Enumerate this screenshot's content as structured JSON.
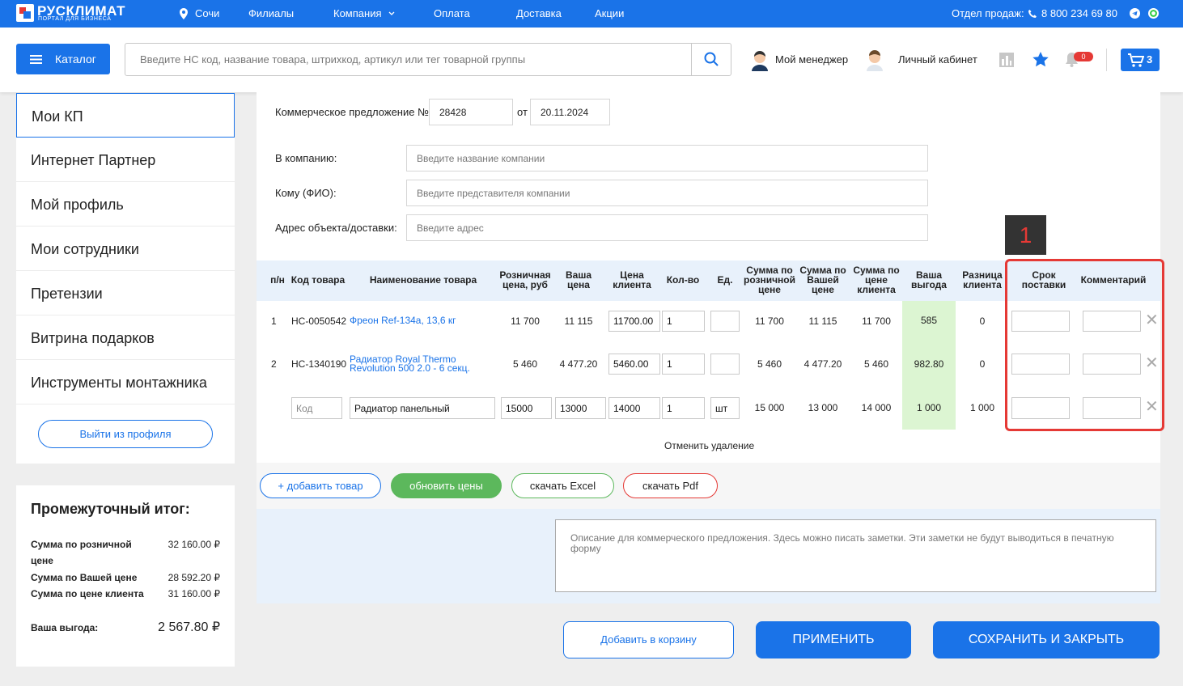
{
  "topbar": {
    "logo_title": "РУСКЛИМАТ",
    "logo_subtitle": "ПОРТАЛ ДЛЯ БИЗНЕСА",
    "city": "Сочи",
    "nav": [
      "Филиалы",
      "Компания",
      "Оплата",
      "Доставка",
      "Акции"
    ],
    "sales_label": "Отдел продаж:",
    "phone": "8 800 234 69 80"
  },
  "header": {
    "catalog_label": "Каталог",
    "search_placeholder": "Введите НС код, название товара, штрихкод, артикул или тег товарной группы",
    "manager_label": "Мой менеджер",
    "cabinet_label": "Личный кабинет",
    "notif_count": "0",
    "cart_count": "3"
  },
  "sidebar": {
    "items": [
      "Мои КП",
      "Интернет Партнер",
      "Мой профиль",
      "Мои сотрудники",
      "Претензии",
      "Витрина подарков",
      "Инструменты монтажника"
    ],
    "logout_label": "Выйти из профиля"
  },
  "summary": {
    "title": "Промежуточный итог:",
    "retail_label_1": "Сумма по розничной",
    "retail_label_2": "цене",
    "retail_value": "32 160.00 ₽",
    "your_label": "Сумма по Вашей цене",
    "your_value": "28 592.20 ₽",
    "client_label": "Сумма по цене клиента",
    "client_value": "31 160.00 ₽",
    "benefit_label": "Ваша выгода:",
    "benefit_value": "2 567.80 ₽"
  },
  "form": {
    "kp_label": "Коммерческое предложение №",
    "kp_number": "28428",
    "from_label": "от",
    "date": "20.11.2024",
    "company_label": "В компанию:",
    "company_placeholder": "Введите название компании",
    "whom_label": "Кому (ФИО):",
    "whom_placeholder": "Введите представителя компании",
    "address_label": "Адрес объекта/доставки:",
    "address_placeholder": "Введите адрес"
  },
  "table": {
    "headers": {
      "num": "п/н",
      "code": "Код товара",
      "name": "Наименование товара",
      "retail_1": "Розничная",
      "retail_2": "цена, руб",
      "your_1": "Ваша",
      "your_2": "цена",
      "client_1": "Цена",
      "client_2": "клиента",
      "qty": "Кол-во",
      "unit": "Ед.",
      "sum_retail_1": "Сумма по",
      "sum_retail_2": "розничной",
      "sum_retail_3": "цене",
      "sum_your_1": "Сумма по",
      "sum_your_2": "Вашей",
      "sum_your_3": "цене",
      "sum_client_1": "Сумма по",
      "sum_client_2": "цене",
      "sum_client_3": "клиента",
      "benefit_1": "Ваша",
      "benefit_2": "выгода",
      "diff_1": "Разница",
      "diff_2": "клиента",
      "term_1": "Срок",
      "term_2": "поставки",
      "comment": "Комментарий"
    },
    "rows": [
      {
        "num": "1",
        "code": "НС-0050542",
        "name_1": "Фреон Ref-134a, 13,6 кг",
        "name_2": "",
        "retail": "11 700",
        "your": "11 115",
        "client": "11700.00",
        "qty": "1",
        "unit": "",
        "sum_retail": "11 700",
        "sum_your": "11 115",
        "sum_client": "11 700",
        "benefit": "585",
        "diff": "0"
      },
      {
        "num": "2",
        "code": "НС-1340190",
        "name_1": "Радиатор Royal Thermo",
        "name_2": "Revolution 500 2.0 - 6 секц.",
        "retail": "5 460",
        "your": "4 477.20",
        "client": "5460.00",
        "qty": "1",
        "unit": "",
        "sum_retail": "5 460",
        "sum_your": "4 477.20",
        "sum_client": "5 460",
        "benefit": "982.80",
        "diff": "0"
      },
      {
        "num": "",
        "code_placeholder": "Код",
        "name": "Радиатор панельный",
        "retail": "15000",
        "your": "13000",
        "client": "14000",
        "qty": "1",
        "unit": "шт",
        "sum_retail": "15 000",
        "sum_your": "13 000",
        "sum_client": "14 000",
        "benefit": "1 000",
        "diff": "1 000"
      }
    ],
    "undo_label": "Отменить удаление"
  },
  "annotation": {
    "marker": "1",
    "color": "#e53935"
  },
  "actions": {
    "add_item": "+ добавить товар",
    "update_prices": "обновить цены",
    "download_excel": "скачать Excel",
    "download_pdf": "скачать Pdf"
  },
  "notes_placeholder": "Описание для коммерческого предложения. Здесь можно писать заметки. Эти заметки не будут выводиться в печатную форму",
  "footer": {
    "add_to_cart": "Добавить в корзину",
    "apply": "ПРИМЕНИТЬ",
    "save_close": "СОХРАНИТЬ И ЗАКРЫТЬ"
  },
  "colors": {
    "accent": "#1a73e8",
    "green": "#5cb85c",
    "benefit_bg": "#dcf5d2",
    "annotation": "#e53935"
  }
}
